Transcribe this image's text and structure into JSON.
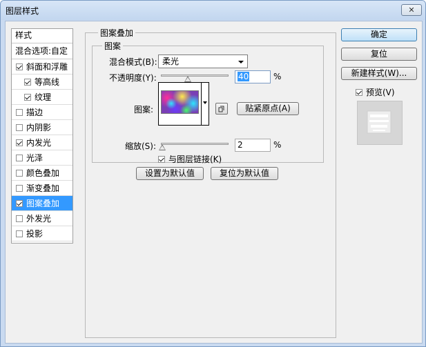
{
  "window": {
    "title": "图层样式",
    "close_label": "✕"
  },
  "styles": {
    "header": "样式",
    "blend_options": "混合选项:自定",
    "items": [
      {
        "label": "斜面和浮雕",
        "checked": true,
        "indent": false,
        "selected": false
      },
      {
        "label": "等高线",
        "checked": true,
        "indent": true,
        "selected": false
      },
      {
        "label": "纹理",
        "checked": true,
        "indent": true,
        "selected": false
      },
      {
        "label": "描边",
        "checked": false,
        "indent": false,
        "selected": false
      },
      {
        "label": "内阴影",
        "checked": false,
        "indent": false,
        "selected": false
      },
      {
        "label": "内发光",
        "checked": true,
        "indent": false,
        "selected": false
      },
      {
        "label": "光泽",
        "checked": false,
        "indent": false,
        "selected": false
      },
      {
        "label": "颜色叠加",
        "checked": false,
        "indent": false,
        "selected": false
      },
      {
        "label": "渐变叠加",
        "checked": false,
        "indent": false,
        "selected": false
      },
      {
        "label": "图案叠加",
        "checked": true,
        "indent": false,
        "selected": true
      },
      {
        "label": "外发光",
        "checked": false,
        "indent": false,
        "selected": false
      },
      {
        "label": "投影",
        "checked": false,
        "indent": false,
        "selected": false
      }
    ]
  },
  "pattern_overlay": {
    "group_title": "图案叠加",
    "sub_title": "图案",
    "blend_mode_label": "混合模式(B):",
    "blend_mode_value": "柔光",
    "opacity_label": "不透明度(Y):",
    "opacity_value": "40",
    "opacity_unit": "%",
    "opacity_fraction": 0.4,
    "pattern_label": "图案:",
    "snap_origin_label": "贴紧原点(A)",
    "scale_label": "缩放(S):",
    "scale_value": "2",
    "scale_unit": "%",
    "scale_fraction": 0.02,
    "link_label": "与图层链接(K)",
    "link_checked": true,
    "set_default_label": "设置为默认值",
    "reset_default_label": "复位为默认值"
  },
  "actions": {
    "ok_label": "确定",
    "reset_label": "复位",
    "new_style_label": "新建样式(W)...",
    "preview_label": "预览(V)",
    "preview_checked": true
  },
  "colors": {
    "selection": "#3399ff",
    "titlebar": "#c9daf0",
    "panel": "#f0f0f0"
  }
}
